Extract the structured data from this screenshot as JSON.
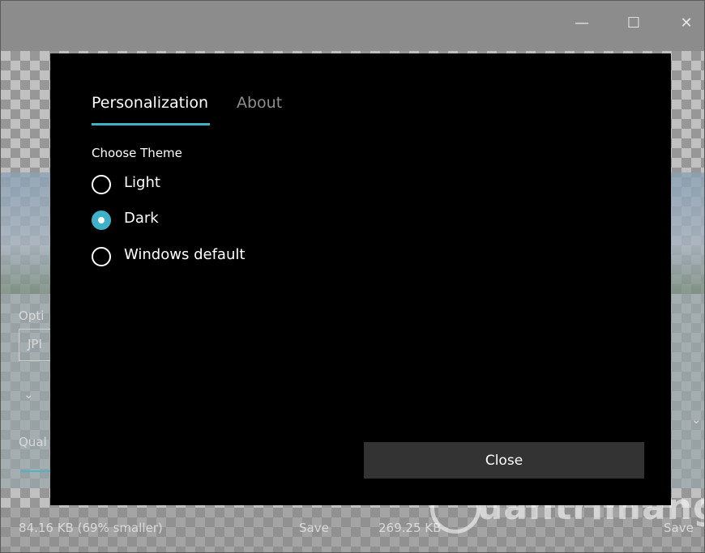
{
  "window": {
    "minimize_glyph": "—",
    "maximize_glyph": "☐",
    "close_glyph": "✕"
  },
  "background": {
    "options_label": "Opti",
    "format_value": "JPI",
    "quality_label": "Qual",
    "left_size": "84.16 KB (69% smaller)",
    "left_save": "Save",
    "right_size": "269.25 KB",
    "right_save": "Save",
    "watermark": "uantrimang"
  },
  "dialog": {
    "tabs": [
      {
        "label": "Personalization",
        "active": true
      },
      {
        "label": "About",
        "active": false
      }
    ],
    "theme_label": "Choose Theme",
    "options": [
      {
        "label": "Light",
        "selected": false
      },
      {
        "label": "Dark",
        "selected": true
      },
      {
        "label": "Windows default",
        "selected": false
      }
    ],
    "close_label": "Close"
  },
  "colors": {
    "accent": "#3fb1c6",
    "dialog_bg": "#000000",
    "button_bg": "#333333"
  }
}
